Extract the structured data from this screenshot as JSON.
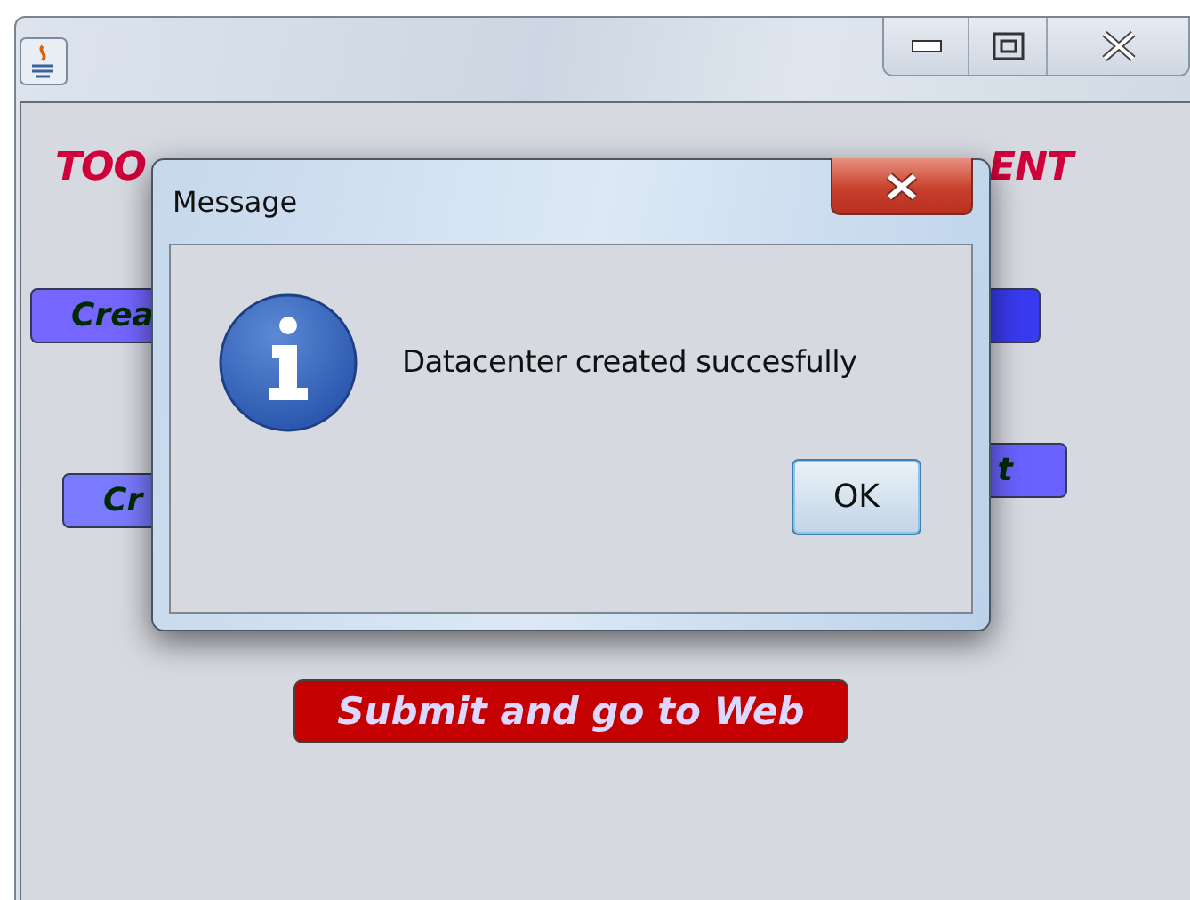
{
  "main_window": {
    "heading_parts": [
      "TOO",
      "ENT"
    ],
    "button_fragments": [
      "Crea",
      "Cr",
      "t"
    ],
    "submit_button": "Submit and go to Web"
  },
  "dialog": {
    "title": "Message",
    "message": "Datacenter created succesfully",
    "buttons": [
      "OK"
    ]
  }
}
